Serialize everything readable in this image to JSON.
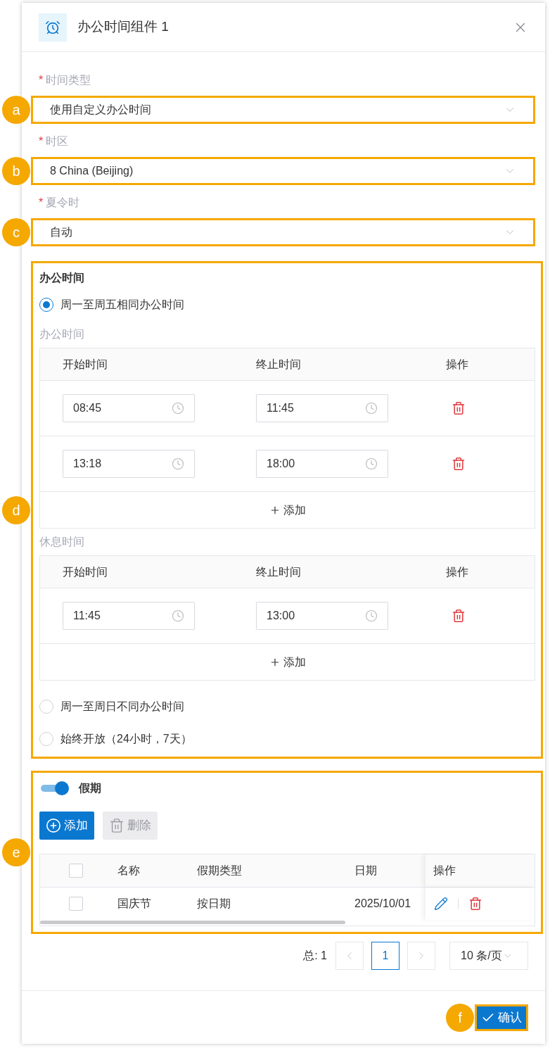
{
  "dialog": {
    "title": "办公时间组件 1"
  },
  "fields": [
    {
      "label": "时间类型",
      "required_mark": "*",
      "value": "使用自定义办公时间",
      "callout": "a"
    },
    {
      "label": "时区",
      "required_mark": "*",
      "value": "8 China (Beijing)",
      "callout": "b"
    },
    {
      "label": "夏令时",
      "required_mark": "*",
      "value": "自动",
      "callout": "c"
    }
  ],
  "office_hours": {
    "callout": "d",
    "title": "办公时间",
    "options": [
      {
        "label": "周一至周五相同办公时间",
        "selected": true
      },
      {
        "label": "周一至周日不同办公时间",
        "selected": false
      },
      {
        "label": "始终开放（24小时，7天）",
        "selected": false
      }
    ],
    "tables": [
      {
        "title": "办公时间",
        "columns": [
          "开始时间",
          "终止时间",
          "操作"
        ],
        "add_label": "添加",
        "rows": [
          {
            "start": "08:45",
            "end": "11:45"
          },
          {
            "start": "13:18",
            "end": "18:00"
          }
        ]
      },
      {
        "title": "休息时间",
        "columns": [
          "开始时间",
          "终止时间",
          "操作"
        ],
        "add_label": "添加",
        "rows": [
          {
            "start": "11:45",
            "end": "13:00"
          }
        ]
      }
    ]
  },
  "holidays": {
    "callout": "e",
    "title": "假期",
    "on": true,
    "add_button": "添加",
    "delete_button": "删除",
    "delete_disabled": true,
    "header_checked": false,
    "columns": [
      "名称",
      "假期类型",
      "日期",
      "操作"
    ],
    "rows": [
      {
        "name": "国庆节",
        "type": "按日期",
        "date": "2025/10/01",
        "checked": false
      }
    ]
  },
  "pagination": {
    "total": "总: 1",
    "pages": [
      {
        "label": "1",
        "selected": true
      }
    ],
    "page_size": "10 条/页"
  },
  "footer": {
    "confirm": "确认",
    "callout": "f"
  }
}
